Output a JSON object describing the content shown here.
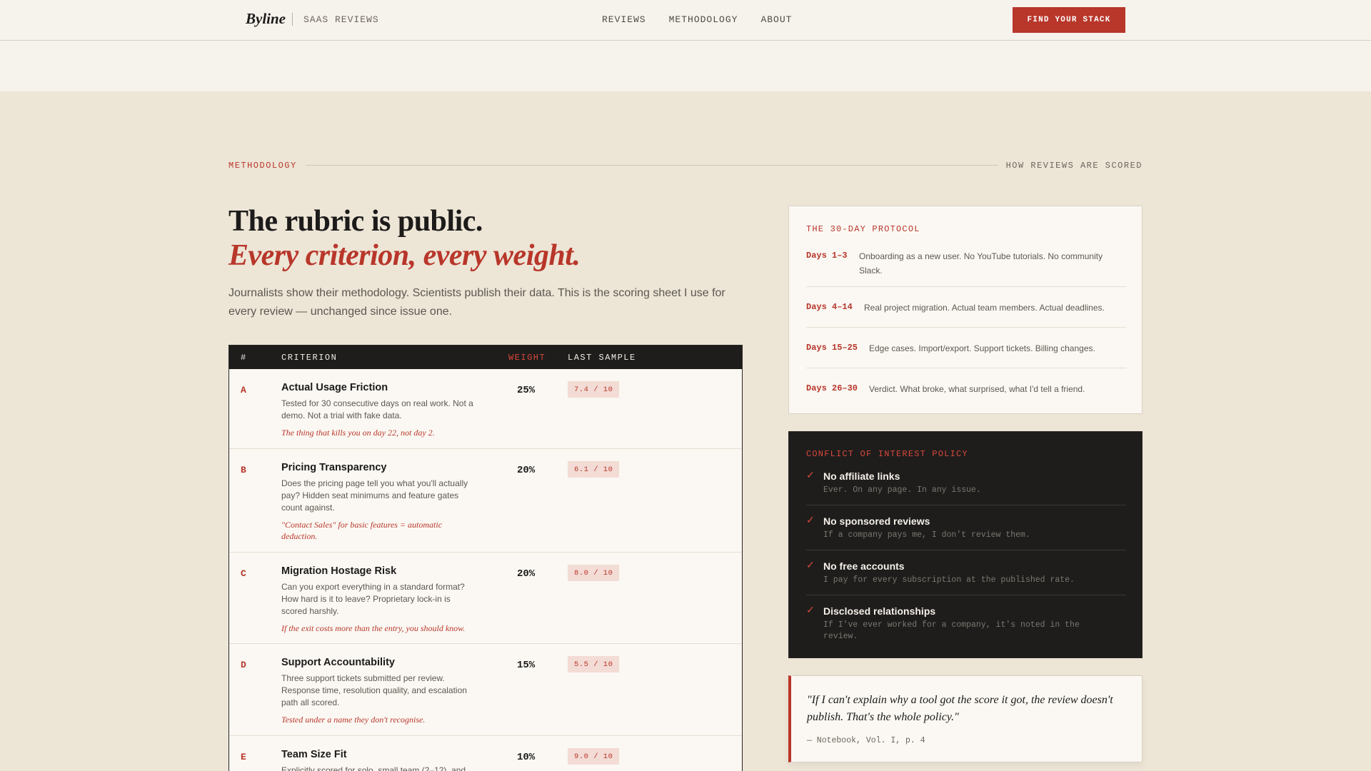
{
  "header": {
    "brand": "Byline",
    "brand_sub": "SAAS REVIEWS",
    "nav": [
      "REVIEWS",
      "METHODOLOGY",
      "ABOUT"
    ],
    "cta": "FIND YOUR STACK"
  },
  "section": {
    "eyebrow": "METHODOLOGY",
    "eyebrow_right": "HOW REVIEWS ARE SCORED",
    "title": "The rubric is public.",
    "title_accent": "Every criterion, every weight.",
    "lede": "Journalists show their methodology. Scientists publish their data. This is the scoring sheet I use for every review — unchanged since issue one."
  },
  "rubric": {
    "headers": {
      "num": "#",
      "criterion": "CRITERION",
      "weight": "WEIGHT",
      "sample": "LAST SAMPLE"
    },
    "rows": [
      {
        "letter": "A",
        "title": "Actual Usage Friction",
        "desc": "Tested for 30 consecutive days on real work. Not a demo. Not a trial with fake data.",
        "note": "The thing that kills you on day 22, not day 2.",
        "weight": "25%",
        "sample": "7.4 / 10"
      },
      {
        "letter": "B",
        "title": "Pricing Transparency",
        "desc": "Does the pricing page tell you what you'll actually pay? Hidden seat minimums and feature gates count against.",
        "note": "\"Contact Sales\" for basic features = automatic deduction.",
        "weight": "20%",
        "sample": "6.1 / 10"
      },
      {
        "letter": "C",
        "title": "Migration Hostage Risk",
        "desc": "Can you export everything in a standard format? How hard is it to leave? Proprietary lock-in is scored harshly.",
        "note": "If the exit costs more than the entry, you should know.",
        "weight": "20%",
        "sample": "8.0 / 10"
      },
      {
        "letter": "D",
        "title": "Support Accountability",
        "desc": "Three support tickets submitted per review. Response time, resolution quality, and escalation path all scored.",
        "note": "Tested under a name they don't recognise.",
        "weight": "15%",
        "sample": "5.5 / 10"
      },
      {
        "letter": "E",
        "title": "Team Size Fit",
        "desc": "Explicitly scored for solo, small team (2–12), and",
        "note": "",
        "weight": "10%",
        "sample": "9.0 / 10"
      }
    ]
  },
  "protocol": {
    "label": "THE 30-DAY PROTOCOL",
    "steps": [
      {
        "days": "Days 1–3",
        "text": "Onboarding as a new user. No YouTube tutorials. No community Slack."
      },
      {
        "days": "Days 4–14",
        "text": "Real project migration. Actual team members. Actual deadlines."
      },
      {
        "days": "Days 15–25",
        "text": "Edge cases. Import/export. Support tickets. Billing changes."
      },
      {
        "days": "Days 26–30",
        "text": "Verdict. What broke, what surprised, what I'd tell a friend."
      }
    ]
  },
  "conflict": {
    "label": "CONFLICT OF INTEREST POLICY",
    "items": [
      {
        "title": "No affiliate links",
        "sub": "Ever. On any page. In any issue."
      },
      {
        "title": "No sponsored reviews",
        "sub": "If a company pays me, I don't review them."
      },
      {
        "title": "No free accounts",
        "sub": "I pay for every subscription at the published rate."
      },
      {
        "title": "Disclosed relationships",
        "sub": "If I've ever worked for a company, it's noted in the review."
      }
    ]
  },
  "quote": {
    "text": "\"If I can't explain why a tool got the score it got, the review doesn't publish. That's the whole policy.\"",
    "cite": "— Notebook, Vol. I, p. 4"
  },
  "colors": {
    "accent": "#b8362a",
    "dark": "#1e1d1c",
    "paper": "#fbf8f3",
    "background": "#ede5d6"
  }
}
